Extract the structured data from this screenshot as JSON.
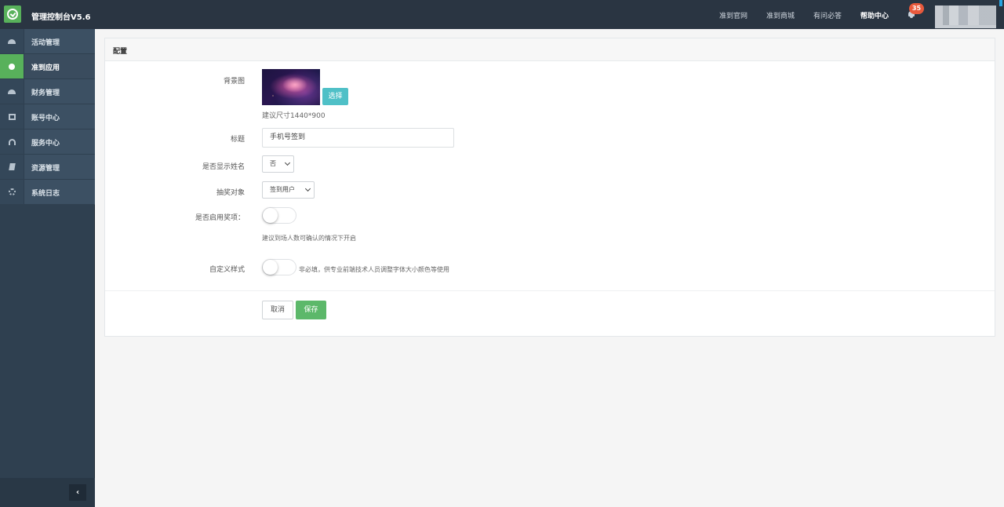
{
  "app": {
    "title": "管理控制台V5.6"
  },
  "topnav": {
    "items": [
      "准到官网",
      "准到商城",
      "有问必答",
      "帮助中心"
    ],
    "notification_count": "35"
  },
  "sidebar": {
    "items": [
      {
        "label": "活动管理",
        "icon": "dashboard-icon"
      },
      {
        "label": "准到应用",
        "icon": "circle-icon",
        "active": true
      },
      {
        "label": "财务管理",
        "icon": "dashboard-icon"
      },
      {
        "label": "账号中心",
        "icon": "id-card-icon"
      },
      {
        "label": "服务中心",
        "icon": "headset-icon"
      },
      {
        "label": "资源管理",
        "icon": "book-icon"
      },
      {
        "label": "系统日志",
        "icon": "gears-icon"
      }
    ],
    "collapse_label": "‹"
  },
  "panel": {
    "title": "配置",
    "background": {
      "label": "背景图",
      "select_button": "选择",
      "hint": "建议尺寸1440*900"
    },
    "title_field": {
      "label": "标题",
      "value": "手机号签到"
    },
    "show_name": {
      "label": "是否显示姓名",
      "value": "否"
    },
    "draw_target": {
      "label": "抽奖对象",
      "value": "签到用户"
    },
    "enable_prize": {
      "label": "是否启用奖项：",
      "hint": "建议到场人数可确认的情况下开启",
      "on": false
    },
    "custom_style": {
      "label": "自定义样式",
      "hint": "非必填，供专业前端技术人员调整字体大小颜色等使用",
      "on": false
    },
    "cancel_button": "取消",
    "save_button": "保存"
  },
  "colors": {
    "topbar": "#2a3542",
    "sidebar": "#2f4050",
    "accent_green": "#58b15b",
    "select_button": "#4fc0c7",
    "badge": "#e8593c"
  }
}
